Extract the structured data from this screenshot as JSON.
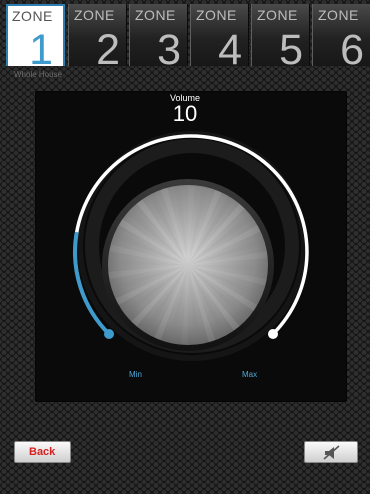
{
  "tabs": [
    {
      "label": "ZONE",
      "number": "1",
      "active": true
    },
    {
      "label": "ZONE",
      "number": "2",
      "active": false
    },
    {
      "label": "ZONE",
      "number": "3",
      "active": false
    },
    {
      "label": "ZONE",
      "number": "4",
      "active": false
    },
    {
      "label": "ZONE",
      "number": "5",
      "active": false
    },
    {
      "label": "ZONE",
      "number": "6",
      "active": false
    }
  ],
  "subtitle": "Whole House",
  "volume": {
    "label": "Volume",
    "value": "10",
    "min_label": "Min",
    "max_label": "Max",
    "level": 0.1
  },
  "buttons": {
    "back_label": "Back",
    "mute_icon": "speaker-muted-icon"
  },
  "colors": {
    "accent": "#3f9bcc",
    "back_text": "#d42020"
  }
}
